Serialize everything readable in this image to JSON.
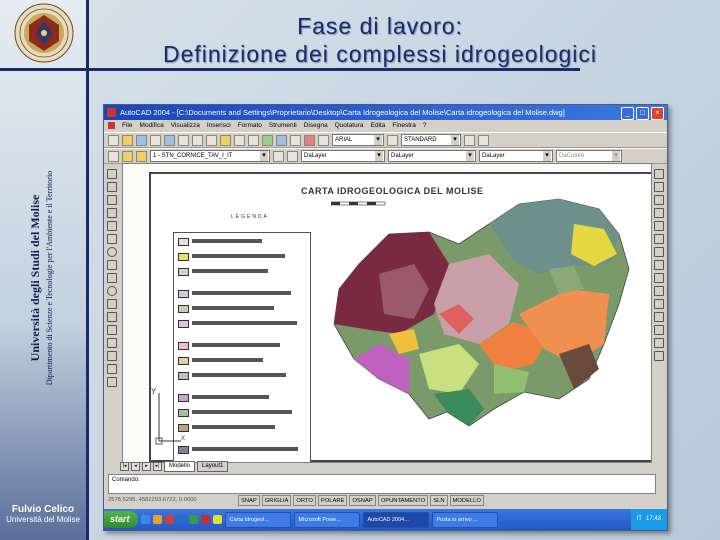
{
  "slide": {
    "title_line1": "Fase di lavoro:",
    "title_line2": "Definizione dei complessi idrogeologici",
    "university": "Università degli Studi del Molise",
    "department": "Dipartimento di Scienze e Tecnologie per l'Ambiente e il Territorio",
    "author_name": "Fulvio Celico",
    "author_affiliation": "Università del Molise"
  },
  "window": {
    "title": "AutoCAD 2004 - [C:\\Documents and Settings\\Proprietario\\Desktop\\Carta Idrogeologica del Molise\\Carta idrogeologica del Molise.dwg]",
    "menu": [
      "File",
      "Modifica",
      "Visualizza",
      "Inserisci",
      "Formato",
      "Strumenti",
      "Disegna",
      "Quotatura",
      "Edita",
      "Finestra",
      "?"
    ],
    "text_style": "ARIAL",
    "dim_style": "STANDARD",
    "layer": "1 - STN_CORNICE_TAV_I_IT",
    "color": "DaLayer",
    "linetype": "DaLayer",
    "lineweight": "DaLayer",
    "plotstyle": "DaColore"
  },
  "drawing": {
    "map_title": "CARTA IDROGEOLOGICA DEL MOLISE",
    "legend_header": "LEGENDA",
    "axis_y": "Y",
    "axis_x": "X"
  },
  "tabs": [
    "Modello",
    "Layout1"
  ],
  "command": {
    "prompt": "Comando:"
  },
  "status": {
    "coords": "2578.5295, 4582293.6722, 0.0000",
    "toggles": [
      "SNAP",
      "GRIGLIA",
      "ORTO",
      "POLARE",
      "OSNAP",
      "OPUNTAMENTO",
      "SLN",
      "MODELLO"
    ]
  },
  "taskbar": {
    "start": "start",
    "tasks": [
      "Carta Idrogeol...",
      "Microsoft Powe...",
      "AutoCAD 2004...",
      "Posta in arrivo ..."
    ],
    "clock": "17:43",
    "lang": "IT"
  },
  "colors": {
    "accent": "#1a2a6c",
    "title_blue": "#1c2b6a",
    "xp_blue": "#2458c8"
  }
}
